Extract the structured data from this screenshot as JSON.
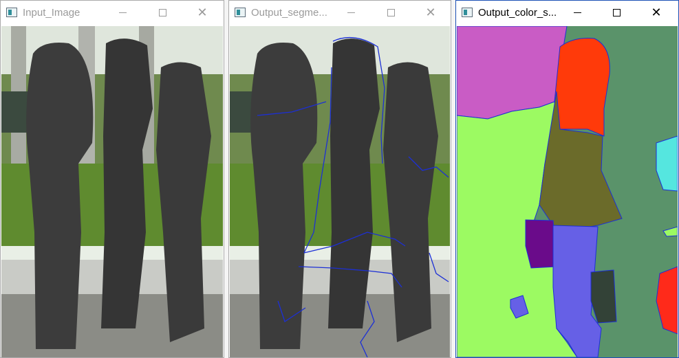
{
  "windows": [
    {
      "title": "Input_Image",
      "state": "inactive"
    },
    {
      "title": "Output_segme...",
      "state": "inactive"
    },
    {
      "title": "Output_color_s...",
      "state": "active"
    }
  ],
  "controls": {
    "minimize": "—",
    "maximize": "□",
    "close": "✕"
  },
  "colors": {
    "segment_boundary": "#1c2fd6",
    "segments": [
      "#c95cc5",
      "#9cfa62",
      "#5a936a",
      "#ff3a0a",
      "#6b6b2a",
      "#6a0b8a",
      "#6660e6",
      "#334237",
      "#55e6df",
      "#ff2a1a"
    ]
  }
}
